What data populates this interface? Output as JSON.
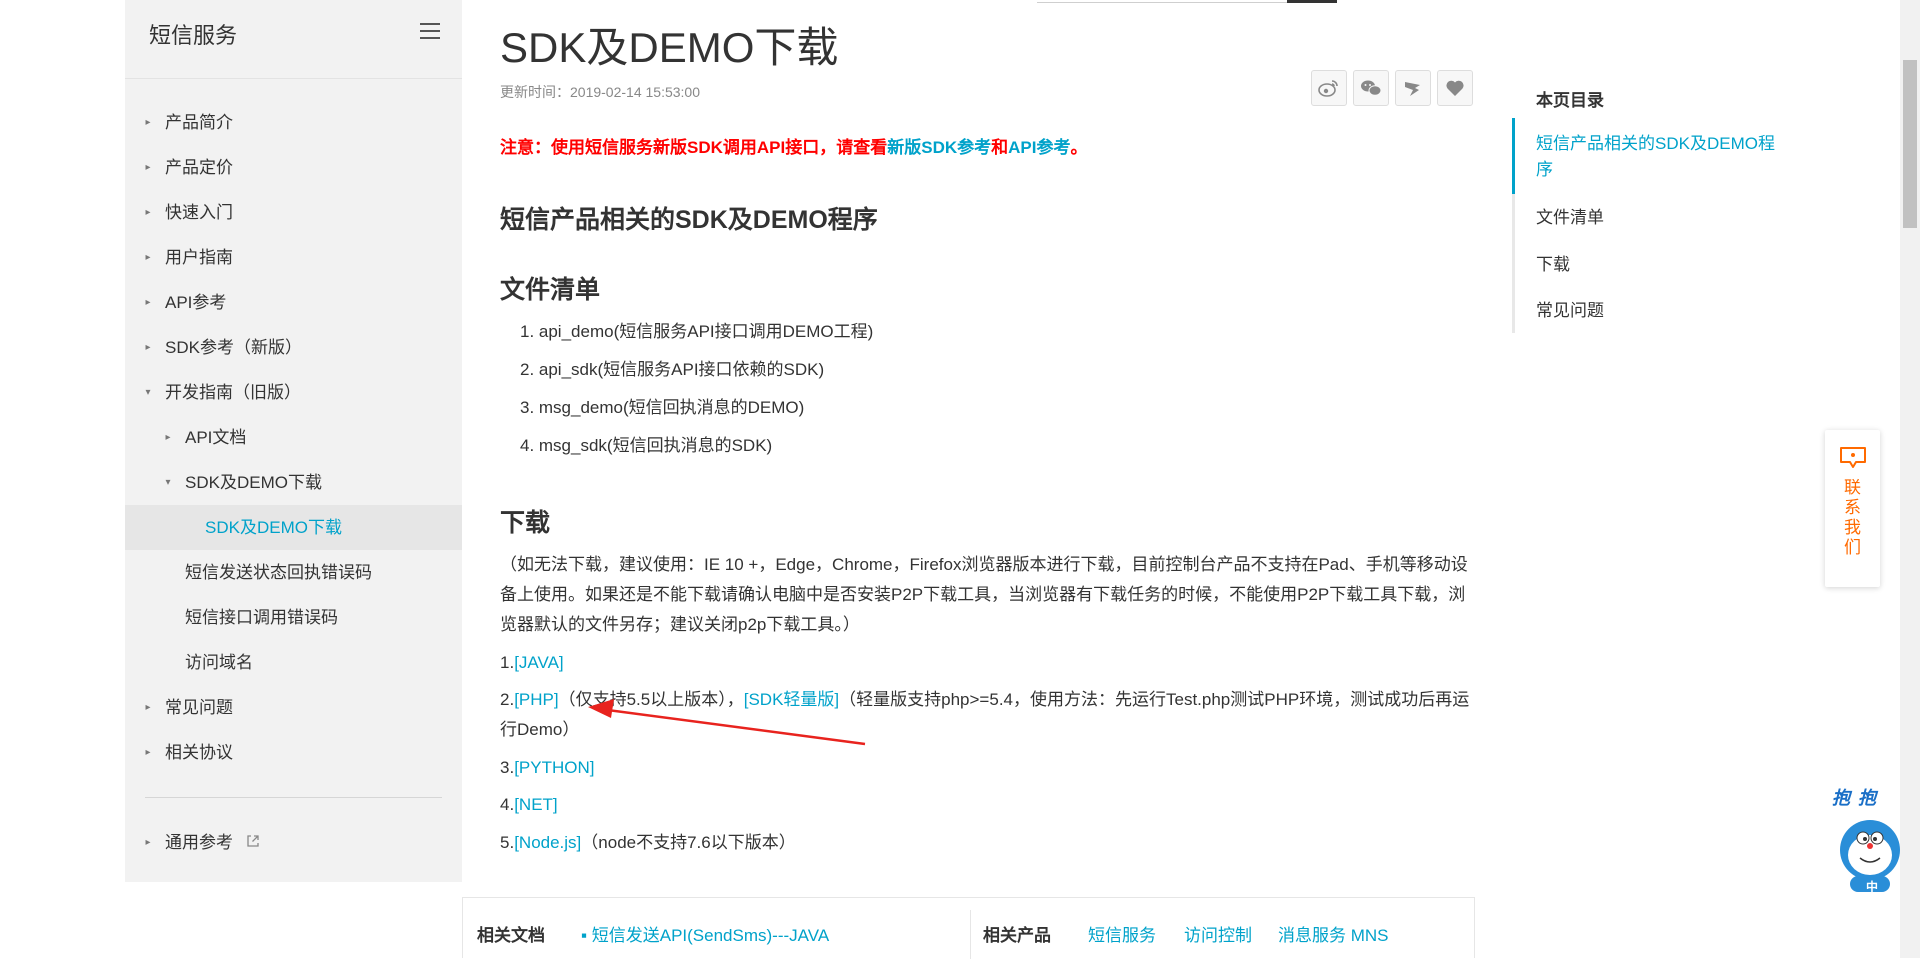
{
  "sidebar": {
    "title": "短信服务",
    "items": [
      {
        "label": "产品简介",
        "level": 0,
        "caret": "▸"
      },
      {
        "label": "产品定价",
        "level": 0,
        "caret": "▸"
      },
      {
        "label": "快速入门",
        "level": 0,
        "caret": "▸"
      },
      {
        "label": "用户指南",
        "level": 0,
        "caret": "▸"
      },
      {
        "label": "API参考",
        "level": 0,
        "caret": "▸"
      },
      {
        "label": "SDK参考（新版）",
        "level": 0,
        "caret": "▸"
      },
      {
        "label": "开发指南（旧版）",
        "level": 0,
        "caret": "▾"
      },
      {
        "label": "API文档",
        "level": 1,
        "caret": "▸"
      },
      {
        "label": "SDK及DEMO下载",
        "level": 1,
        "caret": "▾"
      },
      {
        "label": "SDK及DEMO下载",
        "level": 2,
        "caret": "",
        "active": true
      },
      {
        "label": "短信发送状态回执错误码",
        "level": 1,
        "caret": ""
      },
      {
        "label": "短信接口调用错误码",
        "level": 1,
        "caret": ""
      },
      {
        "label": "访问域名",
        "level": 1,
        "caret": ""
      },
      {
        "label": "常见问题",
        "level": 0,
        "caret": "▸"
      },
      {
        "label": "相关协议",
        "level": 0,
        "caret": "▸"
      }
    ],
    "general_ref": "通用参考"
  },
  "main": {
    "title": "SDK及DEMO下载",
    "update_time": "更新时间：2019-02-14 15:53:00",
    "notice": {
      "prefix": "注意：使用短信服务新版SDK调用API接口，请查看",
      "link1": "新版SDK参考",
      "and": "和",
      "link2": "API参考",
      "suffix": "。"
    },
    "section1": "短信产品相关的SDK及DEMO程序",
    "section2": "文件清单",
    "files": [
      "1. api_demo(短信服务API接口调用DEMO工程)",
      "2. api_sdk(短信服务API接口依赖的SDK)",
      "3. msg_demo(短信回执消息的DEMO)",
      "4. msg_sdk(短信回执消息的SDK)"
    ],
    "section3": "下载",
    "download_note": "（如无法下载，建议使用：IE 10 +，Edge，Chrome，Firefox浏览器版本进行下载，目前控制台产品不支持在Pad、手机等移动设备上使用。如果还是不能下载请确认电脑中是否安装P2P下载工具，当浏览器有下载任务的时候，不能使用P2P下载工具下载，浏览器默认的文件另存；建议关闭p2p下载工具。）",
    "downloads": {
      "java": {
        "num": "1.",
        "link": "[JAVA]"
      },
      "php": {
        "num": "2.",
        "link": "[PHP]",
        "note1": "（仅支持5.5以上版本），",
        "link2": "[SDK轻量版]",
        "note2": "（轻量版支持php>=5.4，使用方法：先运行Test.php测试PHP环境，测试成功后再运行Demo）"
      },
      "python": {
        "num": "3.",
        "link": "[PYTHON]"
      },
      "net": {
        "num": "4.",
        "link": "[NET]"
      },
      "node": {
        "num": "5.",
        "link": "[Node.js]",
        "note": "（node不支持7.6以下版本）"
      }
    }
  },
  "share": {
    "icons": [
      "weibo-icon",
      "wechat-icon",
      "dingtalk-icon",
      "favorite-icon"
    ]
  },
  "related": {
    "docs_title": "相关文档",
    "docs_link": "短信发送API(SendSms)---JAVA",
    "products_title": "相关产品",
    "products": [
      "短信服务",
      "访问控制",
      "消息服务 MNS"
    ]
  },
  "toc": {
    "heading": "本页目录",
    "items": [
      "短信产品相关的SDK及DEMO程序",
      "文件清单",
      "下载",
      "常见问题"
    ]
  },
  "contact": {
    "label": "联系我们"
  },
  "mascot": {
    "bubble": "抱抱",
    "caption": "中"
  },
  "colors": {
    "accent": "#00a2ca",
    "notice_red": "#ff0000",
    "contact_orange": "#ff6a00",
    "sidebar_bg": "#f2f2f2",
    "annotation_arrow": "#e8231e"
  }
}
